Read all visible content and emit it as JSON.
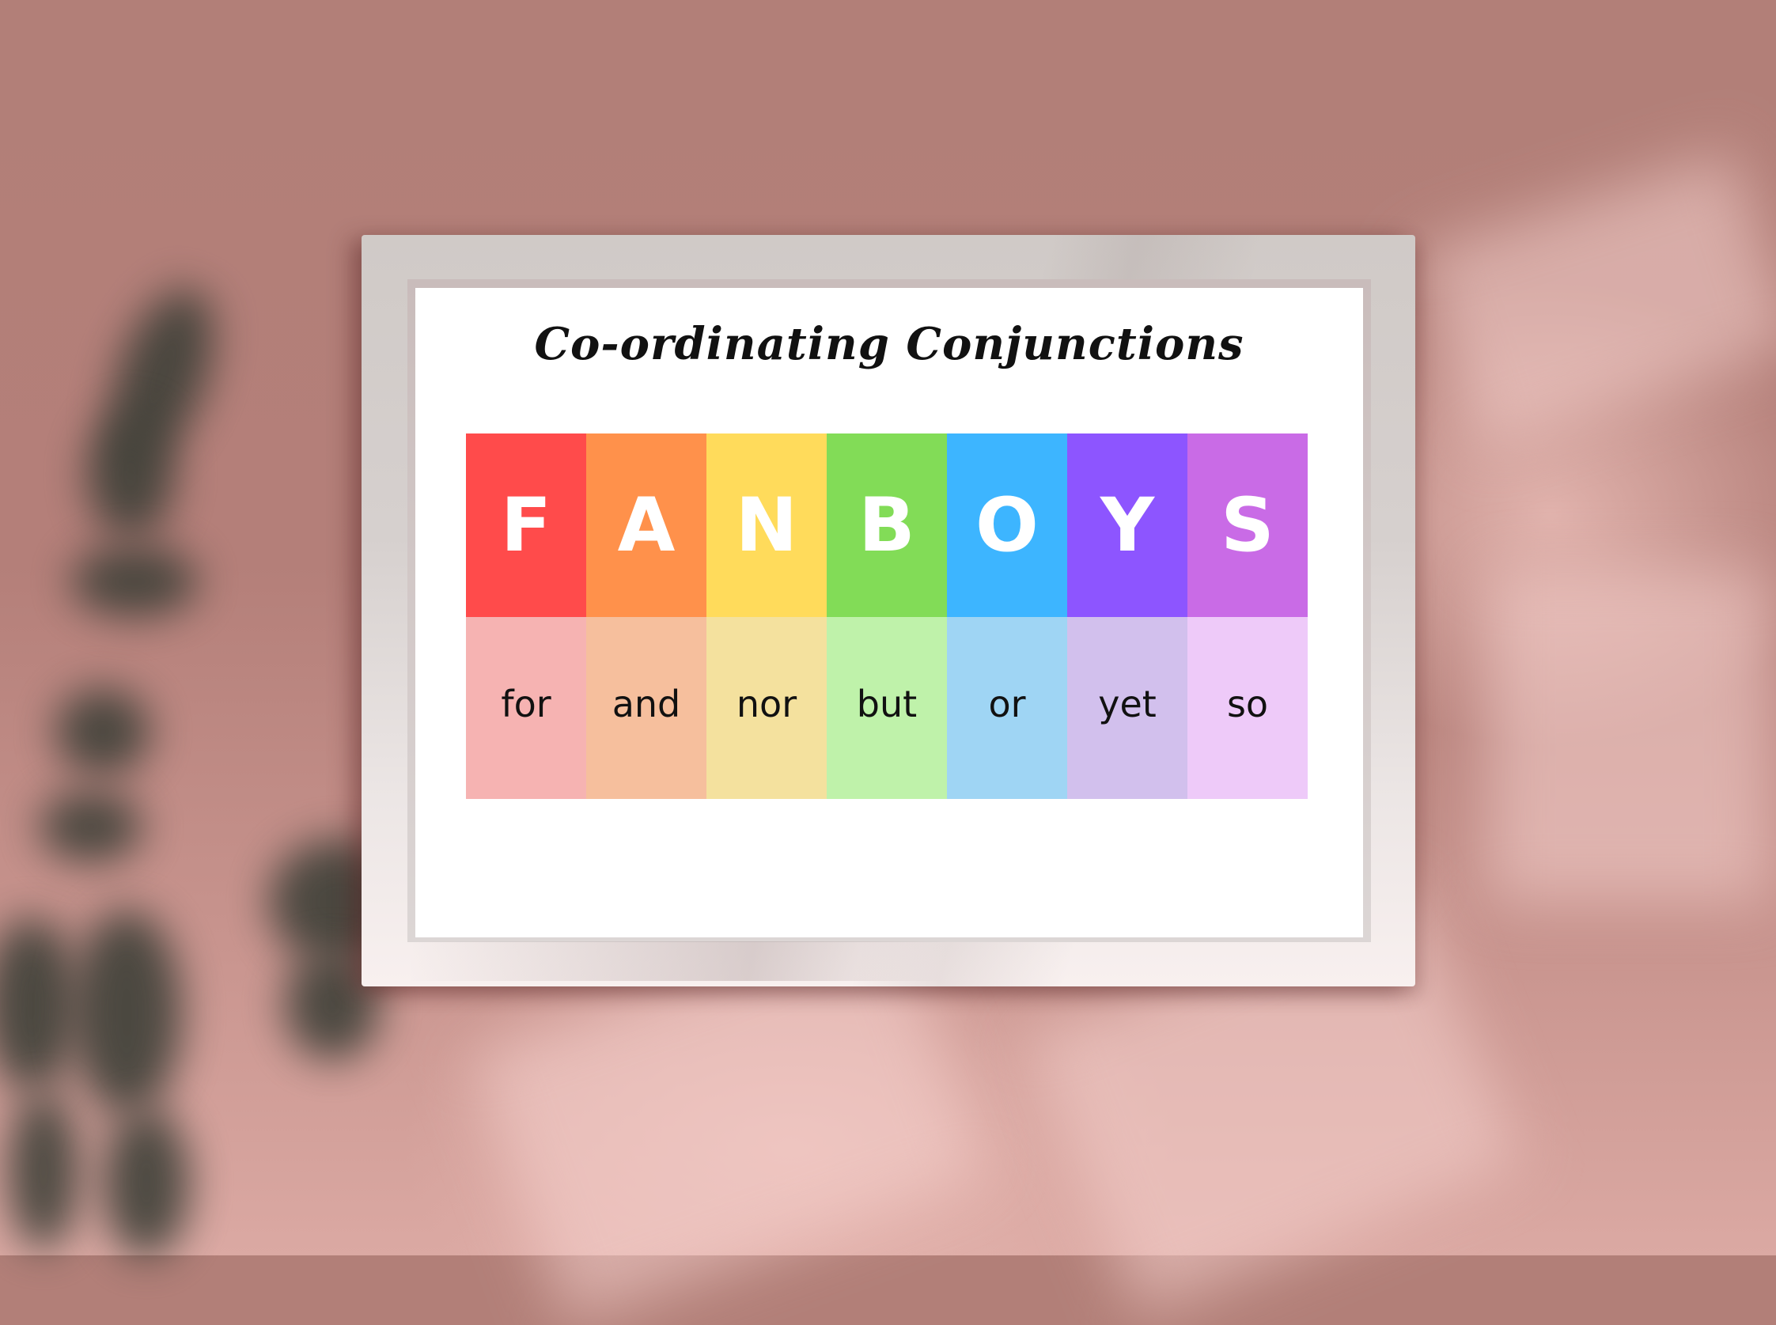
{
  "poster": {
    "title": "Co-ordinating Conjunctions",
    "acronym": "FANBOYS",
    "columns": [
      {
        "letter": "F",
        "word": "for",
        "color": "#ff4b4b",
        "light_color": "#f6b3b2"
      },
      {
        "letter": "A",
        "word": "and",
        "color": "#ff914b",
        "light_color": "#f6bf9d"
      },
      {
        "letter": "N",
        "word": "nor",
        "color": "#ffdb5b",
        "light_color": "#f4e19e"
      },
      {
        "letter": "B",
        "word": "but",
        "color": "#82dc57",
        "light_color": "#bff2aa"
      },
      {
        "letter": "O",
        "word": "or",
        "color": "#3db5ff",
        "light_color": "#9fd5f4"
      },
      {
        "letter": "Y",
        "word": "yet",
        "color": "#8d55ff",
        "light_color": "#d2c0ed"
      },
      {
        "letter": "S",
        "word": "so",
        "color": "#c96be6",
        "light_color": "#eecaf9"
      }
    ]
  },
  "scene": {
    "wall_color": "#b27f78",
    "frame_color": "#d6d0ce",
    "shadow_color": "#3e4038"
  }
}
